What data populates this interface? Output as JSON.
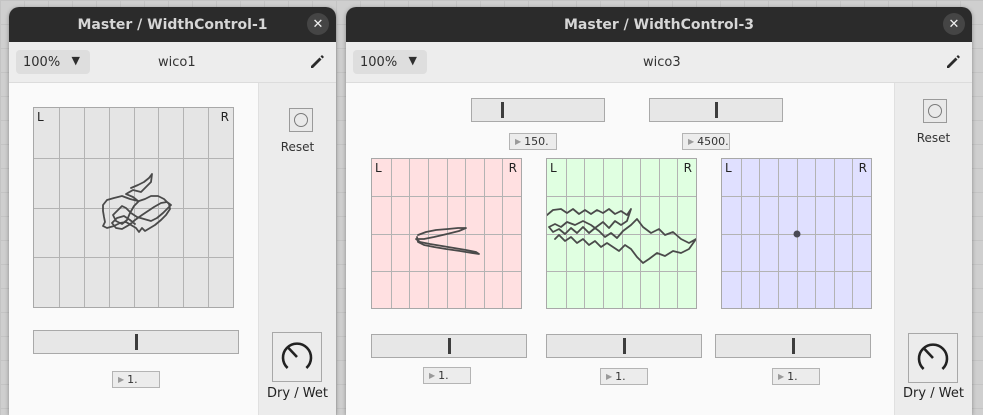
{
  "windows": [
    {
      "title": "Master / WidthControl-1",
      "zoom": "100%",
      "preset": "wico1",
      "reset_label": "Reset",
      "drywet_label": "Dry / Wet",
      "corner_left": "L",
      "corner_right": "R",
      "width_slider": {
        "value_text": "1.",
        "level": 0.5
      },
      "panel_bg": "#e5e5e5"
    },
    {
      "title": "Master / WidthControl-3",
      "zoom": "100%",
      "preset": "wico3",
      "reset_label": "Reset",
      "drywet_label": "Dry / Wet",
      "corner_left": "L",
      "corner_right": "R",
      "crossover_sliders": [
        {
          "value_text": "150.",
          "level": 0.23
        },
        {
          "value_text": "4500.",
          "level": 0.5
        }
      ],
      "bands": [
        {
          "color": "#ffe0e1",
          "value_text": "1.",
          "level": 0.5
        },
        {
          "color": "#e0ffe1",
          "value_text": "1.",
          "level": 0.5
        },
        {
          "color": "#e0e0ff",
          "value_text": "1.",
          "level": 0.5
        }
      ]
    }
  ],
  "icons": {
    "close": "close-icon",
    "edit": "pencil-icon",
    "zoom_dropdown": "chevron-down-icon",
    "reset": "reset-circle-icon",
    "drywet": "knob-icon"
  }
}
